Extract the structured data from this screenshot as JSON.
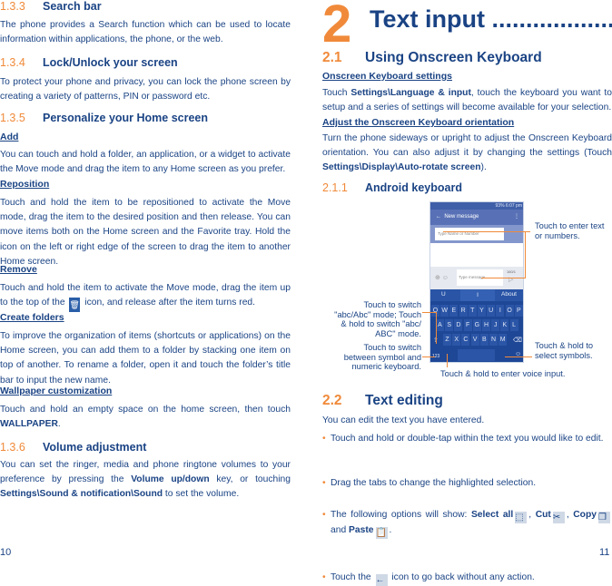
{
  "left": {
    "s133": {
      "num": "1.3.3",
      "title": "Search bar",
      "text": [
        {
          "t": "The phone provides a Search function which can be used to locate information within applications, the phone, or the web."
        }
      ]
    },
    "s134": {
      "num": "1.3.4",
      "title": "Lock/Unlock your screen",
      "text": [
        {
          "t": "To protect your phone and privacy, you can lock the phone screen by creating a variety of patterns, PIN or password etc."
        }
      ]
    },
    "s135": {
      "num": "1.3.5",
      "title": "Personalize your Home screen"
    },
    "add": {
      "title": "Add",
      "text": [
        {
          "t": "You can touch and hold a folder, an application, or a widget to activate the Move mode and drag the item to any Home screen as you prefer."
        }
      ]
    },
    "reposition": {
      "title": "Reposition ",
      "text": [
        {
          "t": "Touch and hold the item to be repositioned to activate the Move mode, drag the item to the desired position and then release.  You can move items both on the Home screen and the Favorite tray. Hold the icon on the left or right edge of the screen to drag the item to another Home screen."
        }
      ]
    },
    "remove": {
      "title": "Remove",
      "text": [
        {
          "t": "Touch and hold the item to activate the Move mode, drag the item up to the top of the "
        },
        {
          "icon": "trash-icon",
          "g": "🗑"
        },
        {
          "t": " icon, and release after the item turns red."
        }
      ]
    },
    "folders": {
      "title": "Create folders",
      "text": [
        {
          "t": "To improve the organization of items (shortcuts or applications) on the Home screen, you can add them to a folder by stacking one item on top of another. To rename a folder, open it and touch the folder’s title bar to input the new name."
        }
      ]
    },
    "wallpaper": {
      "title": "Wallpaper customization",
      "text": [
        {
          "t": "Touch and hold an empty space on the home screen, then touch "
        },
        {
          "t": "WALLPAPER",
          "b": true
        },
        {
          "t": "."
        }
      ]
    },
    "s136": {
      "num": "1.3.6",
      "title": "Volume adjustment",
      "text": [
        {
          "t": "You can set the ringer, media and phone ringtone volumes to your preference by pressing the "
        },
        {
          "t": "Volume up/down",
          "b": true
        },
        {
          "t": " key, or touching "
        },
        {
          "t": "Settings\\Sound & notification\\Sound",
          "b": true
        },
        {
          "t": " to set the volume."
        }
      ]
    },
    "page": "10"
  },
  "right": {
    "chapter_num": "2",
    "chapter_title": "Text input ....................",
    "s21": {
      "num": "2.1",
      "title": "Using Onscreen Keyboard"
    },
    "kbsettings": {
      "title": "Onscreen Keyboard settings",
      "text": [
        {
          "t": "Touch "
        },
        {
          "t": "Settings\\Language & input",
          "b": true
        },
        {
          "t": ", touch the keyboard you want to setup and a series of settings will become available for your selection."
        }
      ]
    },
    "orient": {
      "title": "Adjust the Onscreen Keyboard orientation",
      "text": [
        {
          "t": "Turn the phone sideways or upright to adjust the Onscreen Keyboard orientation. You can also adjust it by changing the settings (Touch "
        },
        {
          "t": "Settings\\Display\\Auto-rotate screen",
          "b": true
        },
        {
          "t": ")."
        }
      ]
    },
    "s211": {
      "num": "2.1.1",
      "title": "Android keyboard"
    },
    "figure": {
      "status": "93% 6:07 pm",
      "app_title": "New message",
      "to_placeholder": "Type Name or Number",
      "msg_placeholder": "Type message",
      "counter": "160/1",
      "suggestions": [
        "U",
        "I",
        "About"
      ],
      "rows": [
        [
          "Q",
          "W",
          "E",
          "R",
          "T",
          "Y",
          "U",
          "I",
          "O",
          "P"
        ],
        [
          "A",
          "S",
          "D",
          "F",
          "G",
          "H",
          "J",
          "K",
          "L"
        ],
        [
          "Z",
          "X",
          "C",
          "V",
          "B",
          "N",
          "M"
        ]
      ],
      "sym_key": "123",
      "callouts": {
        "enter_text": "Touch to enter text or numbers.",
        "switch_mode": "Touch to switch \"abc/Abc\" mode; Touch & hold to switch \"abc/ ABC\" mode.",
        "switch_symbol": "Touch to switch between symbol and numeric keyboard.",
        "select_symbols": "Touch & hold to select symbols.",
        "voice": "Touch & hold to enter voice input."
      }
    },
    "s22": {
      "num": "2.2",
      "title": "Text editing",
      "intro": "You can edit the text you have entered."
    },
    "bullets": [
      [
        {
          "t": "Touch and hold or double-tap within the text you would like to edit."
        }
      ],
      [
        {
          "t": "Drag the tabs to change the highlighted selection."
        }
      ],
      [
        {
          "t": "The following options will show: "
        },
        {
          "t": "Select all",
          "b": true
        },
        {
          "icon": "select-all-icon",
          "g": "⬚"
        },
        {
          "t": ", "
        },
        {
          "t": "Cut",
          "b": true
        },
        {
          "icon": "cut-icon",
          "g": "✂"
        },
        {
          "t": ", "
        },
        {
          "t": "Copy",
          "b": true
        },
        {
          "icon": "copy-icon",
          "g": "❐"
        },
        {
          "t": " and "
        },
        {
          "t": "Paste",
          "b": true
        },
        {
          "icon": "paste-icon",
          "g": "📋"
        },
        {
          "t": "."
        }
      ],
      [
        {
          "t": "Touch the "
        },
        {
          "icon": "back-arrow-icon",
          "g": "←"
        },
        {
          "t": " icon to go back without any action."
        }
      ]
    ],
    "page": "11"
  }
}
